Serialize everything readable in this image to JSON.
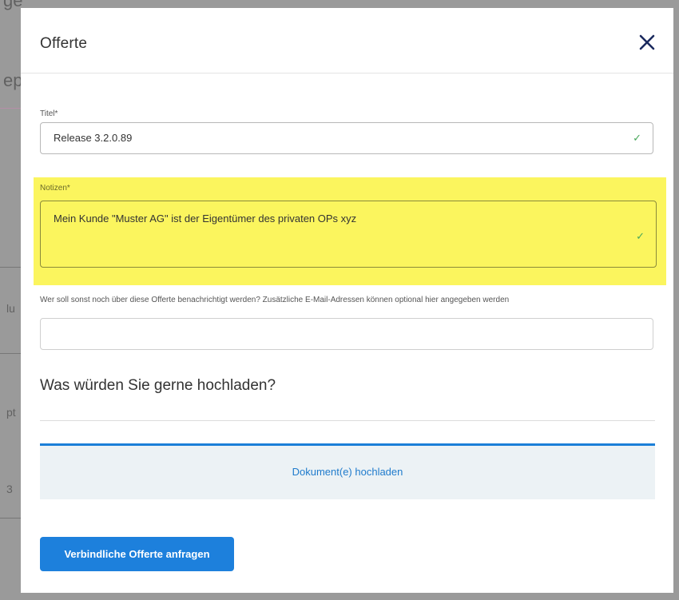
{
  "modal": {
    "title": "Offerte"
  },
  "form": {
    "titel": {
      "label": "Titel*",
      "value": "Release 3.2.0.89",
      "valid_mark": "✓"
    },
    "notizen": {
      "label": "Notizen*",
      "value": "Mein Kunde \"Muster AG\" ist der Eigentümer des privaten OPs xyz",
      "valid_mark": "✓"
    },
    "email": {
      "label": "Wer soll sonst noch über diese Offerte benachrichtigt werden? Zusätzliche E-Mail-Adressen können optional hier angegeben werden",
      "value": "",
      "placeholder": ""
    }
  },
  "upload": {
    "heading": "Was würden Sie gerne hochladen?",
    "button_label": "Dokument(e) hochladen"
  },
  "actions": {
    "submit_label": "Verbindliche Offerte anfragen"
  },
  "colors": {
    "accent": "#1d80dc",
    "highlight": "#fbf55e",
    "valid": "#48a85a",
    "title_close": "#1b2a5e"
  },
  "icons": {
    "close": "close-icon",
    "valid": "checkmark-icon"
  }
}
